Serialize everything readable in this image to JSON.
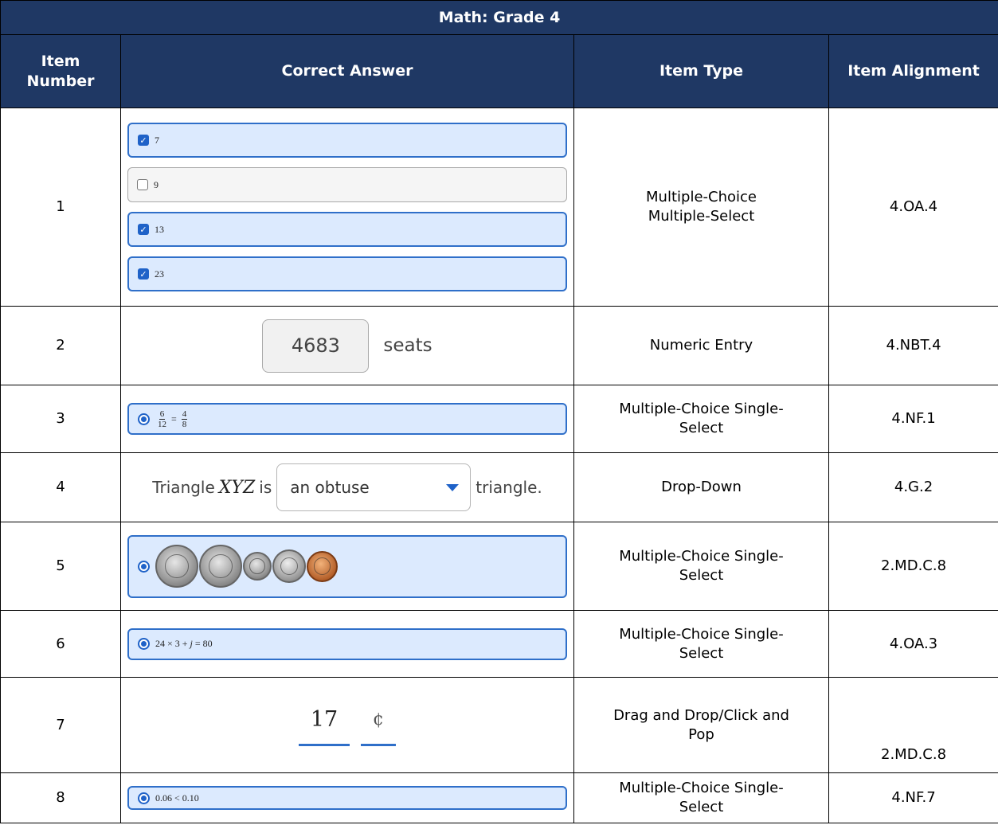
{
  "title": "Math: Grade 4",
  "headers": {
    "item_number": "Item Number",
    "correct_answer": "Correct Answer",
    "item_type": "Item Type",
    "item_alignment": "Item Alignment"
  },
  "rows": [
    {
      "number": "1",
      "type": "Multiple-Choice Multiple-Select",
      "alignment": "4.OA.4",
      "options": [
        {
          "label": "7",
          "checked": true
        },
        {
          "label": "9",
          "checked": false
        },
        {
          "label": "13",
          "checked": true
        },
        {
          "label": "23",
          "checked": true
        }
      ]
    },
    {
      "number": "2",
      "type": "Numeric Entry",
      "alignment": "4.NBT.4",
      "value": "4683",
      "unit": "seats"
    },
    {
      "number": "3",
      "type": "Multiple-Choice Single-Select",
      "alignment": "4.NF.1",
      "fraction_left": {
        "num": "6",
        "den": "12"
      },
      "equals": "=",
      "fraction_right": {
        "num": "4",
        "den": "8"
      }
    },
    {
      "number": "4",
      "type": "Drop-Down",
      "alignment": "4.G.2",
      "prefix": "Triangle",
      "variable": "XYZ",
      "is_text": "is",
      "selected": "an obtuse",
      "suffix": "triangle."
    },
    {
      "number": "5",
      "type": "Multiple-Choice Single-Select",
      "alignment": "2.MD.C.8",
      "coins": [
        "quarter",
        "quarter",
        "dime",
        "nickel",
        "penny"
      ]
    },
    {
      "number": "6",
      "type": "Multiple-Choice Single-Select",
      "alignment": "4.OA.3",
      "expression": "24 × 3 + j = 80"
    },
    {
      "number": "7",
      "type": "Drag and Drop/Click and Pop",
      "alignment": "2.MD.C.8",
      "value": "17",
      "unit": "¢"
    },
    {
      "number": "8",
      "type": "Multiple-Choice Single-Select",
      "alignment": "4.NF.7",
      "expression": "0.06 < 0.10"
    }
  ],
  "colors": {
    "header_bg": "#1f3864",
    "selected_border": "#2f6fc9",
    "selected_fill": "#dceafe"
  }
}
